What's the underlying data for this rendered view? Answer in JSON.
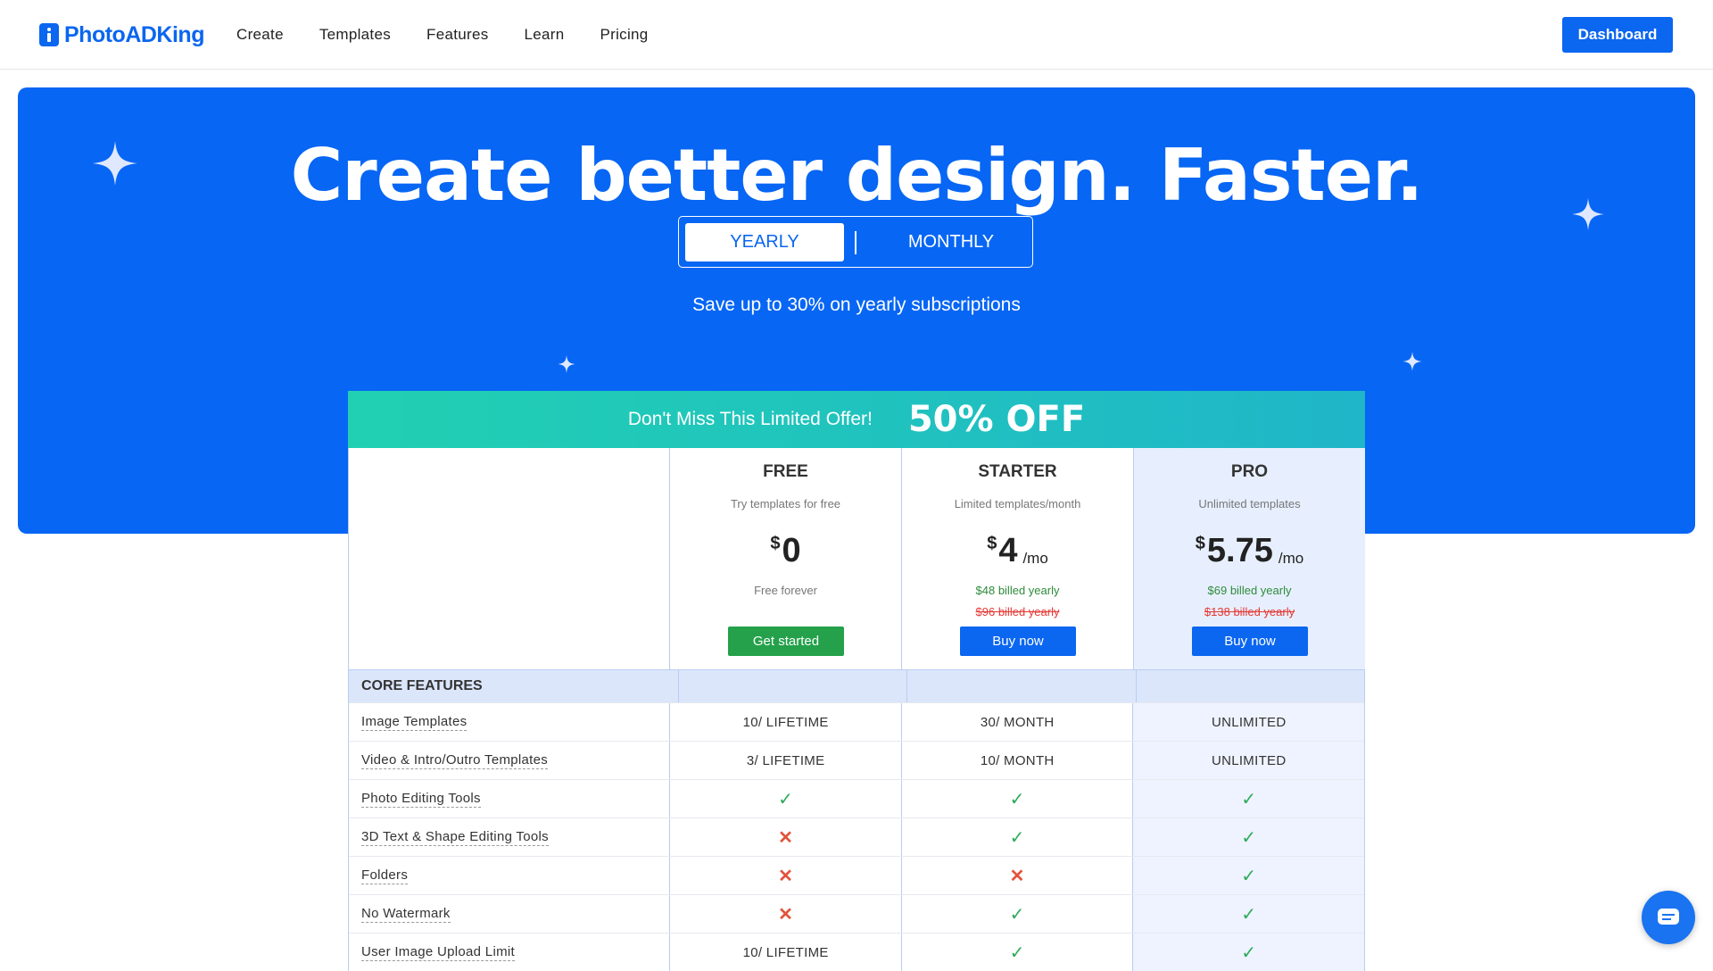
{
  "header": {
    "logo_text": "PhotoADKing",
    "nav": [
      "Create",
      "Templates",
      "Features",
      "Learn",
      "Pricing"
    ],
    "dashboard_label": "Dashboard"
  },
  "hero": {
    "title": "Create better design. Faster.",
    "toggle": {
      "yearly": "YEARLY",
      "monthly": "MONTHLY",
      "selected": "YEARLY"
    },
    "save_text": "Save up to 30% on yearly subscriptions"
  },
  "offer": {
    "text": "Don't Miss This Limited Offer!",
    "discount": "50% OFF"
  },
  "plans": [
    {
      "name": "FREE",
      "desc": "Try templates for free",
      "currency": "$",
      "amount": "0",
      "per": "",
      "billed": "Free forever",
      "old": "",
      "button": "Get started"
    },
    {
      "name": "STARTER",
      "desc": "Limited templates/month",
      "currency": "$",
      "amount": "4",
      "per": "/mo",
      "billed": "$48 billed yearly",
      "old": "$96 billed yearly",
      "button": "Buy now"
    },
    {
      "name": "PRO",
      "desc": "Unlimited templates",
      "currency": "$",
      "amount": "5.75",
      "per": "/mo",
      "billed": "$69 billed yearly",
      "old": "$138 billed yearly",
      "button": "Buy now"
    }
  ],
  "features": {
    "section_title": "CORE FEATURES",
    "rows": [
      {
        "label": "Image Templates",
        "free": "10/ LIFETIME",
        "starter": "30/ MONTH",
        "pro": "UNLIMITED"
      },
      {
        "label": "Video & Intro/Outro Templates",
        "free": "3/ LIFETIME",
        "starter": "10/ MONTH",
        "pro": "UNLIMITED"
      },
      {
        "label": "Photo Editing Tools",
        "free": "✓",
        "starter": "✓",
        "pro": "✓"
      },
      {
        "label": "3D Text & Shape Editing Tools",
        "free": "✕",
        "starter": "✓",
        "pro": "✓"
      },
      {
        "label": "Folders",
        "free": "✕",
        "starter": "✕",
        "pro": "✓"
      },
      {
        "label": "No Watermark",
        "free": "✕",
        "starter": "✓",
        "pro": "✓"
      },
      {
        "label": "User Image Upload Limit",
        "free": "10/ LIFETIME",
        "starter": "✓",
        "pro": "✓"
      }
    ]
  },
  "icons": {
    "chat": "chat-icon",
    "sparkle": "sparkle-icon",
    "logo": "logo-icon"
  },
  "colors": {
    "brand": "#0b66f0",
    "offer_start": "#21d0b2",
    "offer_end": "#1fb6c9",
    "check": "#2eaa5a",
    "cross": "#e2533c"
  }
}
